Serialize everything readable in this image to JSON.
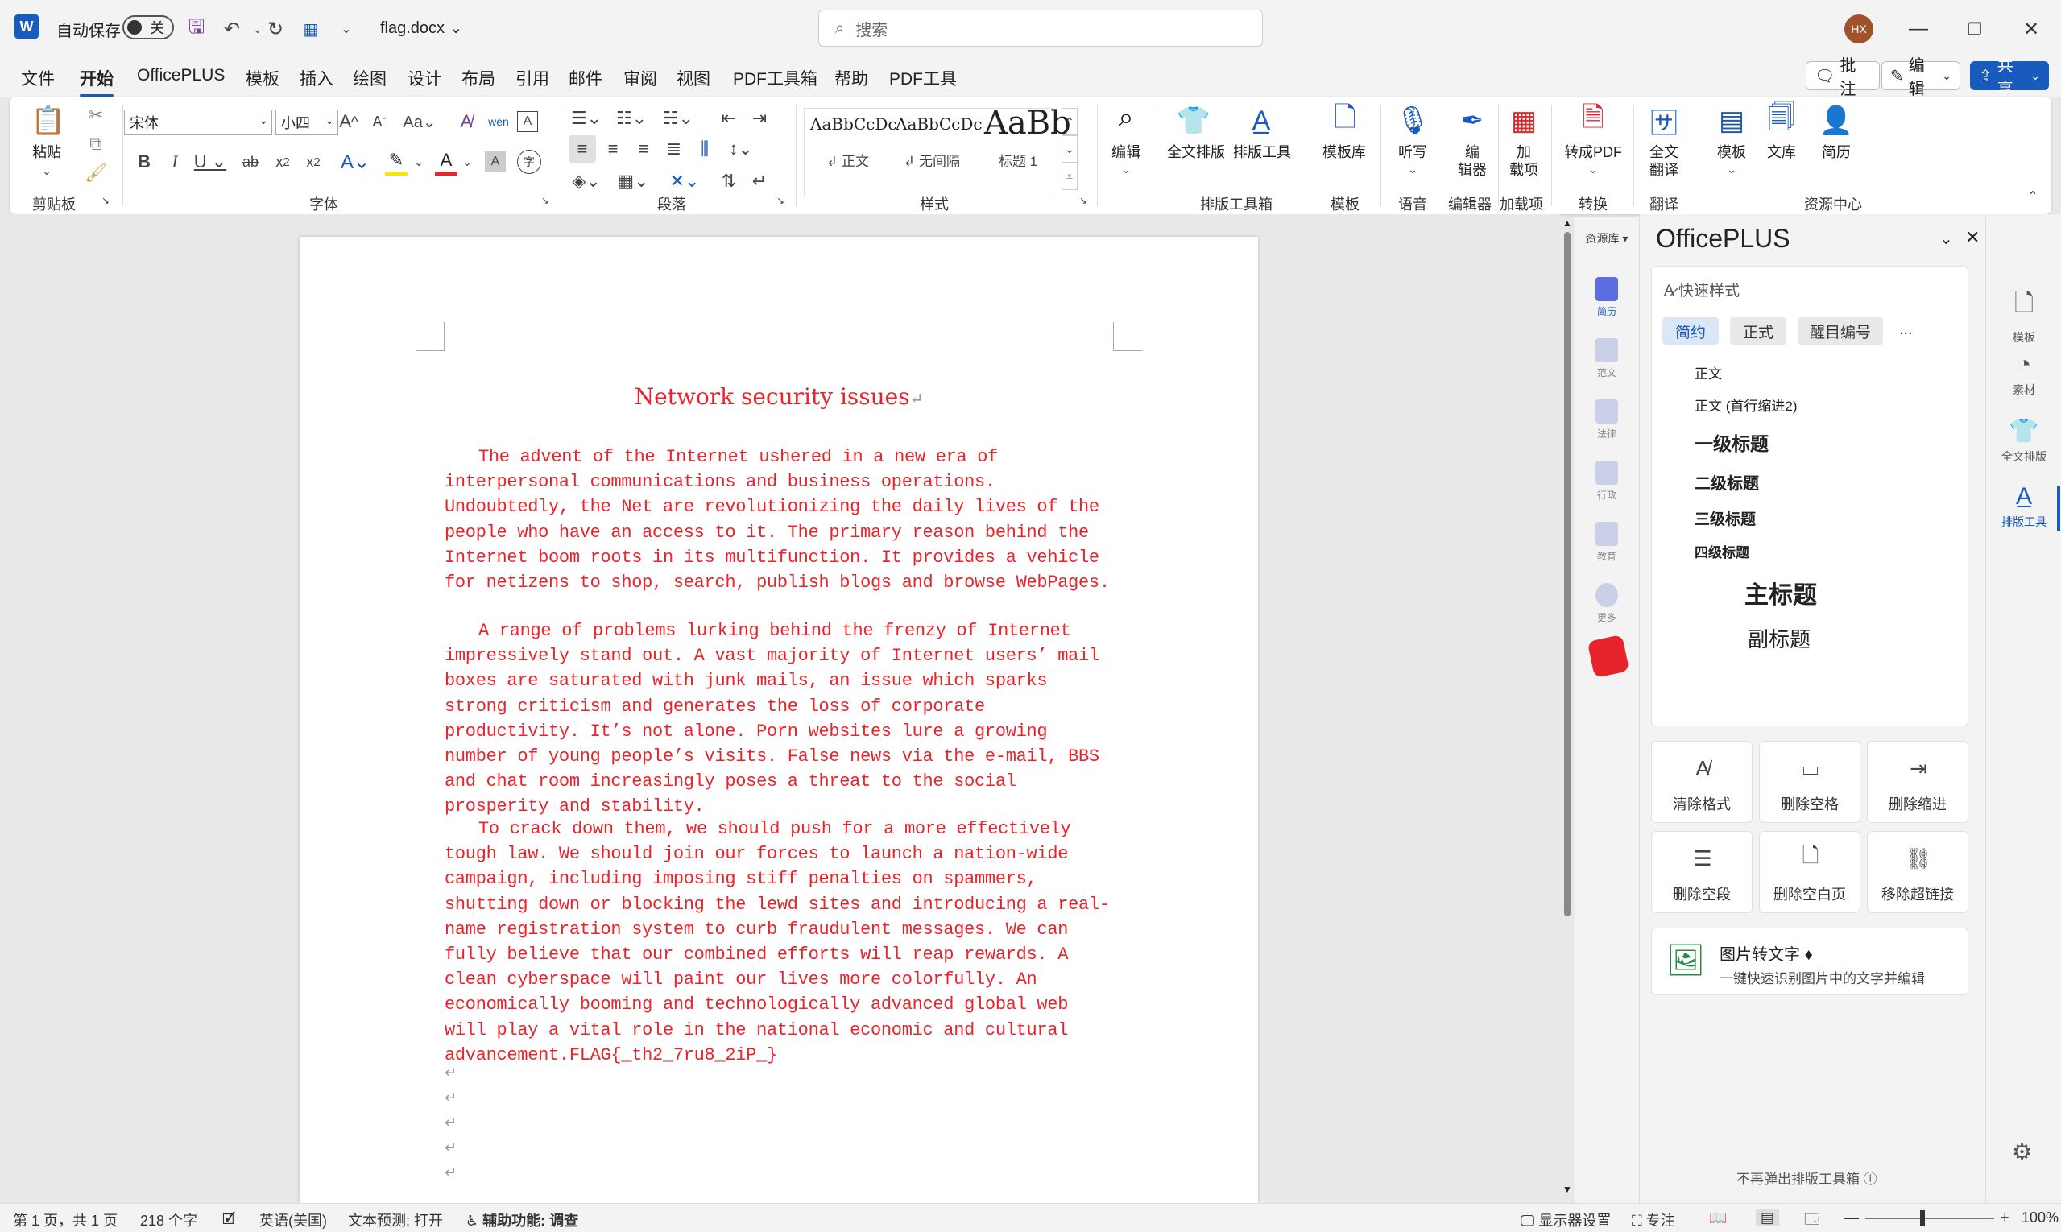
{
  "titlebar": {
    "app_letter": "W",
    "autosave_label": "自动保存",
    "autosave_state": "关",
    "filename": "flag.docx",
    "search_placeholder": "搜索",
    "avatar_initials": "HX"
  },
  "menu": {
    "tabs": [
      "文件",
      "开始",
      "OfficePLUS",
      "模板",
      "插入",
      "绘图",
      "设计",
      "布局",
      "引用",
      "邮件",
      "审阅",
      "视图",
      "PDF工具箱",
      "帮助",
      "PDF工具"
    ],
    "active": "开始",
    "comment_btn": "批注",
    "edit_btn": "编辑",
    "share_btn": "共享"
  },
  "ribbon": {
    "paste": "粘贴",
    "font_name": "宋体",
    "font_size": "小四",
    "groups": {
      "clipboard": "剪贴板",
      "font": "字体",
      "paragraph": "段落",
      "styles": "样式",
      "layout_box": "排版工具箱",
      "template": "模板",
      "voice": "语音",
      "editor": "编辑器",
      "addins": "加载项",
      "convert": "转换",
      "translate": "翻译",
      "resource": "资源中心"
    },
    "styles": [
      {
        "sample": "AaBbCcDc",
        "name": "正文"
      },
      {
        "sample": "AaBbCcDc",
        "name": "无间隔"
      },
      {
        "sample": "AaBb",
        "name": "标题 1"
      }
    ],
    "buttons": {
      "edit": "编辑",
      "full_layout": "全文排版",
      "layout_tool": "排版工具",
      "template_lib": "模板库",
      "dictate": "听写",
      "editor_l1": "编",
      "editor_l2": "辑器",
      "addin_l1": "加",
      "addin_l2": "载项",
      "topdf": "转成PDF",
      "translate_l1": "全文",
      "translate_l2": "翻译",
      "template": "模板",
      "library": "文库",
      "resume": "简历"
    }
  },
  "document": {
    "title": "Network security issues",
    "paragraphs": [
      "The advent of the Internet ushered in a new era of interpersonal communications and business operations. Undoubtedly, the Net are revolutionizing the daily lives of the people who have an access to it. The primary reason behind the Internet boom roots in its multifunction. It provides a vehicle for netizens to shop, search, publish blogs and browse WebPages.",
      "A range of problems lurking behind the frenzy of Internet impressively stand out. A vast majority of Internet users’ mail boxes are saturated with junk mails, an issue which sparks strong criticism and generates the loss of corporate productivity. It’s not alone. Porn websites lure a growing number of young people’s visits. False news via the e-mail, BBS and chat room increasingly poses a threat to the social prosperity and stability.",
      "To crack down them, we should push for a more effectively tough law. We should join our forces to launch a nation-wide campaign, including imposing stiff penalties on spammers, shutting down or blocking the lewd sites and introducing a real-name registration system to curb fraudulent messages. We can fully believe that our combined efforts will reap rewards. A clean cyberspace will paint our lives more colorfully. An economically booming and technologically advanced global web will play a vital role in the national economic and cultural advancement.FLAG{_th2_7ru8_2iP_}"
    ]
  },
  "resources": {
    "header": "资源库",
    "items": [
      "简历",
      "范文",
      "法律",
      "行政",
      "教育",
      "更多"
    ]
  },
  "panel": {
    "title": "OfficePLUS",
    "quick_styles_title": "快速样式",
    "tabs": [
      "简约",
      "正式",
      "醒目编号"
    ],
    "more": "...",
    "styles": [
      "正文",
      "正文 (首行缩进2)",
      "一级标题",
      "二级标题",
      "三级标题",
      "四级标题",
      "主标题",
      "副标题"
    ],
    "tools": [
      "清除格式",
      "删除空格",
      "删除缩进",
      "删除空段",
      "删除空白页",
      "移除超链接"
    ],
    "ocr_title": "图片转文字",
    "ocr_desc": "一键快速识别图片中的文字并编辑",
    "footer": "不再弹出排版工具箱"
  },
  "rail": {
    "items": [
      "模板",
      "素材",
      "全文排版",
      "排版工具"
    ],
    "selected": "排版工具"
  },
  "status": {
    "page": "第 1 页，共 1 页",
    "words": "218 个字",
    "lang": "英语(美国)",
    "predict": "文本预测: 打开",
    "access": "辅助功能: 调查",
    "display": "显示器设置",
    "focus": "专注",
    "zoom": "100%"
  },
  "colors": {
    "accent": "#185abd",
    "doc_text": "#e8242b"
  }
}
